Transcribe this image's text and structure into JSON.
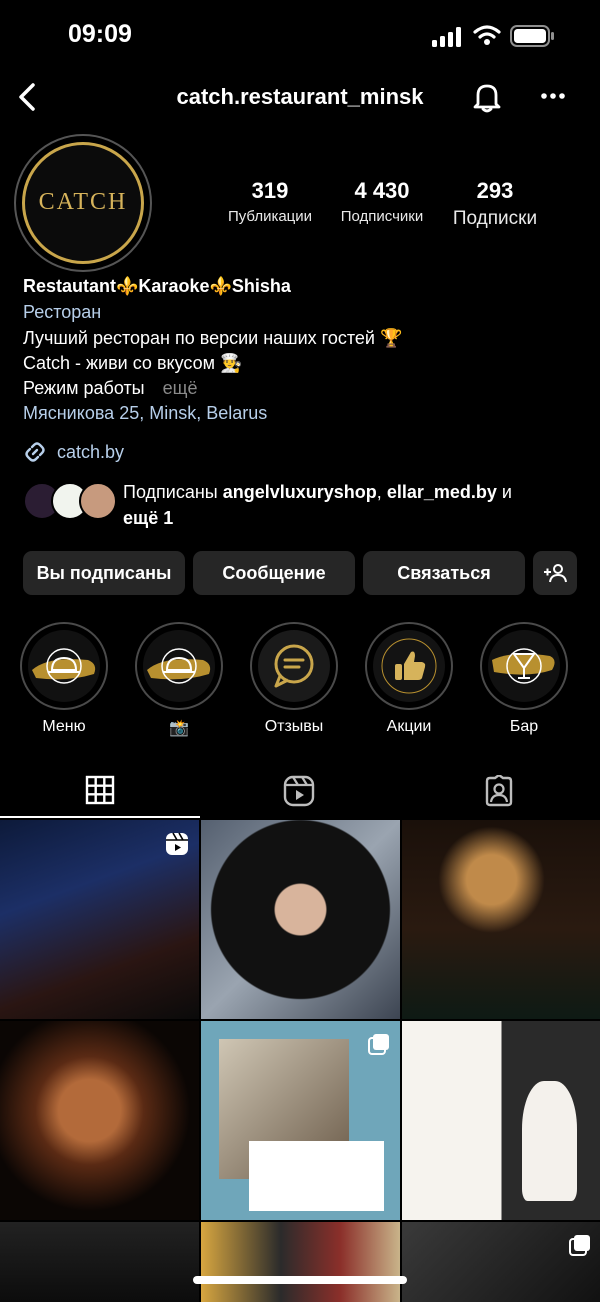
{
  "status": {
    "time": "09:09"
  },
  "header": {
    "username": "catch.restaurant_minsk"
  },
  "profile": {
    "avatar_text": "CATCH",
    "stats": [
      {
        "value": "319",
        "label": "Публикации"
      },
      {
        "value": "4 430",
        "label": "Подписчики"
      },
      {
        "value": "293",
        "label": "Подписки"
      }
    ],
    "name": "Restautant⚜️Karaoke⚜️Shisha",
    "category": "Ресторан",
    "bio_line1": "Лучший ресторан по версии наших гостей 🏆",
    "bio_line2": "Catch - живи со вкусом 👨‍🍳",
    "bio_line3": "Режим работы",
    "bio_more": "ещё",
    "address": "Мясникова 25, Minsk, Belarus",
    "link": "catch.by",
    "followed_by_prefix": "Подписаны ",
    "followed_by_user1": "angelvluxuryshop",
    "followed_by_sep": ", ",
    "followed_by_user2": "ellar_med.by",
    "followed_by_and": " и",
    "followed_by_more": "ещё 1"
  },
  "actions": {
    "following": "Вы подписаны",
    "message": "Сообщение",
    "contact": "Связаться"
  },
  "highlights": [
    {
      "label": "Меню",
      "icon": "cloche-icon"
    },
    {
      "label": "📸",
      "icon": "cloche-icon"
    },
    {
      "label": "Отзывы",
      "icon": "chat-icon"
    },
    {
      "label": "Акции",
      "icon": "thumbs-up-icon"
    },
    {
      "label": "Бар",
      "icon": "cocktail-icon"
    }
  ],
  "colors": {
    "accent_gold": "#c9a64b",
    "button_bg": "#262626",
    "link": "#b7cfea"
  }
}
